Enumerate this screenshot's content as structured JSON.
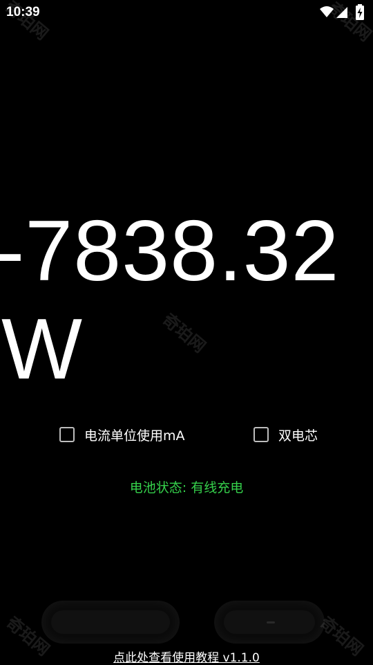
{
  "status_bar": {
    "time": "10:39",
    "icons": [
      "wifi-icon",
      "cellular-signal-icon",
      "battery-charging-icon"
    ]
  },
  "reading": {
    "value": "-7838.32",
    "unit": "W"
  },
  "options": {
    "current_unit_ma_label": "电流单位使用mA",
    "current_unit_ma_checked": false,
    "dual_cell_label": "双电芯",
    "dual_cell_checked": false
  },
  "battery_status": {
    "text": "电池状态: 有线充电",
    "color": "#35d04b"
  },
  "footer": {
    "tutorial_link": "点此处查看使用教程  v1.1.0"
  },
  "watermark": {
    "text": "奇珀网"
  }
}
